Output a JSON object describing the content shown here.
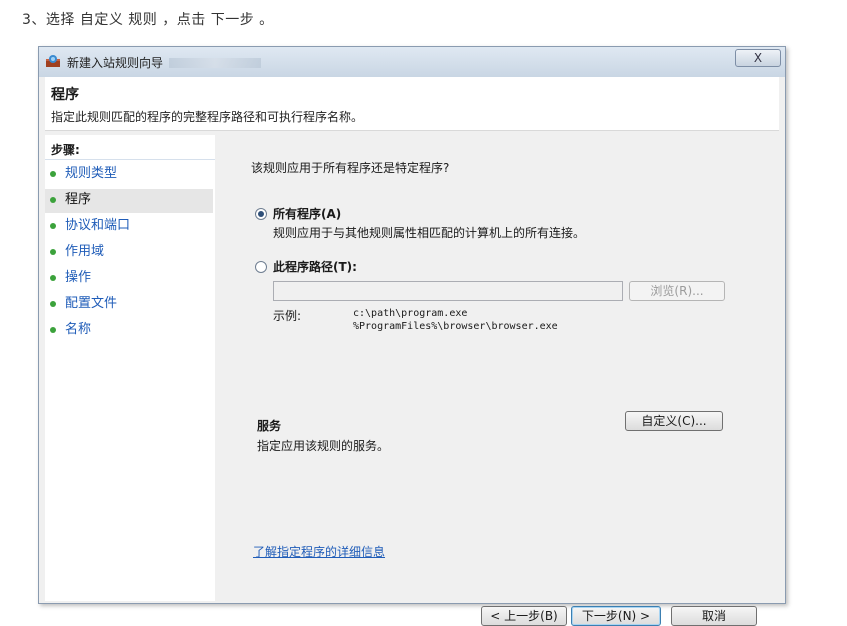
{
  "caption": "3、选择 自定义 规则 ，点击 下一步 。",
  "window": {
    "title": "新建入站规则向导",
    "close_label": "X"
  },
  "header": {
    "title": "程序",
    "description": "指定此规则匹配的程序的完整程序路径和可执行程序名称。"
  },
  "steps": {
    "label": "步骤:",
    "items": [
      {
        "label": "规则类型"
      },
      {
        "label": "程序"
      },
      {
        "label": "协议和端口"
      },
      {
        "label": "作用域"
      },
      {
        "label": "操作"
      },
      {
        "label": "配置文件"
      },
      {
        "label": "名称"
      }
    ],
    "active_index": 1
  },
  "content": {
    "question": "该规则应用于所有程序还是特定程序?",
    "all_programs": {
      "label": "所有程序(A)",
      "description": "规则应用于与其他规则属性相匹配的计算机上的所有连接。",
      "checked": true
    },
    "program_path": {
      "label": "此程序路径(T):",
      "checked": false,
      "value": "",
      "browse_label": "浏览(R)...",
      "example_label": "示例:",
      "example_lines": "c:\\path\\program.exe\n%ProgramFiles%\\browser\\browser.exe"
    },
    "services": {
      "title": "服务",
      "description": "指定应用该规则的服务。",
      "customize_label": "自定义(C)..."
    },
    "learn_more": "了解指定程序的详细信息"
  },
  "buttons": {
    "back": "< 上一步(B)",
    "next": "下一步(N) >",
    "cancel": "取消"
  },
  "colors": {
    "link": "#1f5cb8",
    "step_bullet": "#3ba23b"
  }
}
